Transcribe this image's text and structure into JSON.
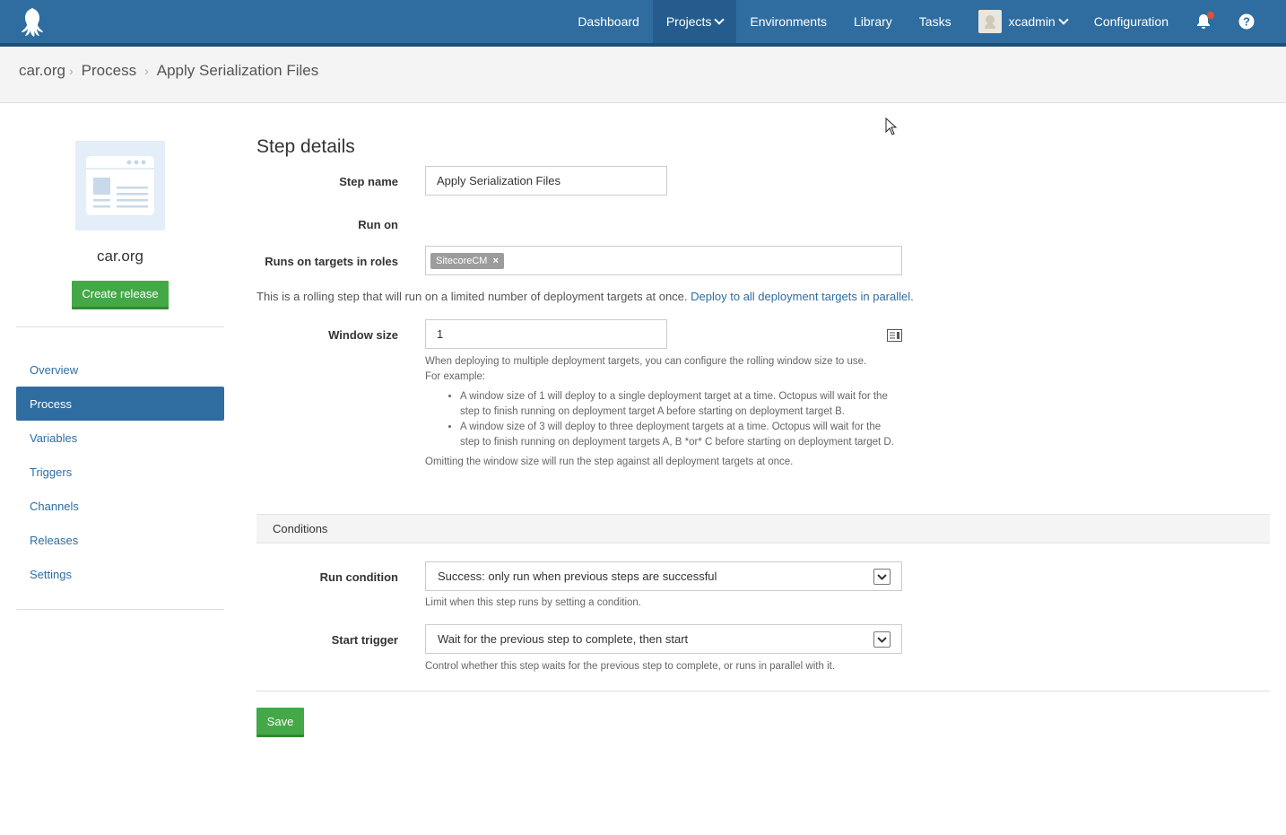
{
  "nav": {
    "items": [
      "Dashboard",
      "Projects",
      "Environments",
      "Library",
      "Tasks"
    ],
    "user": "xcadmin",
    "configuration": "Configuration"
  },
  "breadcrumb": [
    "car.org",
    "Process",
    "Apply Serialization Files"
  ],
  "sidebar": {
    "project_name": "car.org",
    "create_release": "Create release",
    "items": [
      "Overview",
      "Process",
      "Variables",
      "Triggers",
      "Channels",
      "Releases",
      "Settings"
    ],
    "active": "Process"
  },
  "main": {
    "title": "Step details",
    "step_name_label": "Step name",
    "step_name_value": "Apply Serialization Files",
    "run_on_label": "Run on",
    "roles_label": "Runs on targets in roles",
    "role_chip": "SitecoreCM",
    "rolling_text": "This is a rolling step that will run on a limited number of deployment targets at once.",
    "rolling_link": "Deploy to all deployment targets in parallel",
    "window_label": "Window size",
    "window_value": "1",
    "window_help_1": "When deploying to multiple deployment targets, you can configure the rolling window size to use.",
    "window_help_2": "For example:",
    "window_help_bullet_1": "A window size of 1 will deploy to a single deployment target at a time. Octopus will wait for the step to finish running on deployment target A before starting on deployment target B.",
    "window_help_bullet_2": "A window size of 3 will deploy to three deployment targets at a time. Octopus will wait for the step to finish running on deployment targets A, B *or* C before starting on deployment target D.",
    "window_help_3": "Omitting the window size will run the step against all deployment targets at once.",
    "conditions_header": "Conditions",
    "run_condition_label": "Run condition",
    "run_condition_value": "Success: only run when previous steps are successful",
    "run_condition_help": "Limit when this step runs by setting a condition.",
    "start_trigger_label": "Start trigger",
    "start_trigger_value": "Wait for the previous step to complete, then start",
    "start_trigger_help": "Control whether this step waits for the previous step to complete, or runs in parallel with it.",
    "save": "Save"
  },
  "colors": {
    "primary": "#2f6da0",
    "success": "#44a847",
    "notification": "#e94b3c"
  }
}
